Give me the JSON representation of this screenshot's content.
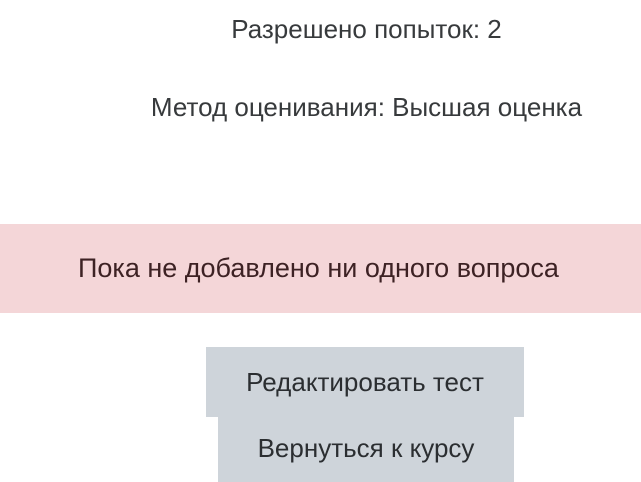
{
  "quiz_info": {
    "attempts_allowed": "Разрешено попыток: 2",
    "grading_method": "Метод оценивания: Высшая оценка"
  },
  "alert": {
    "message": "Пока не добавлено ни одного вопроса",
    "background_color": "#f4d6d8"
  },
  "actions": {
    "edit_quiz_label": "Редактировать тест",
    "back_to_course_label": "Вернуться к курсу",
    "button_color": "#ced4da"
  }
}
